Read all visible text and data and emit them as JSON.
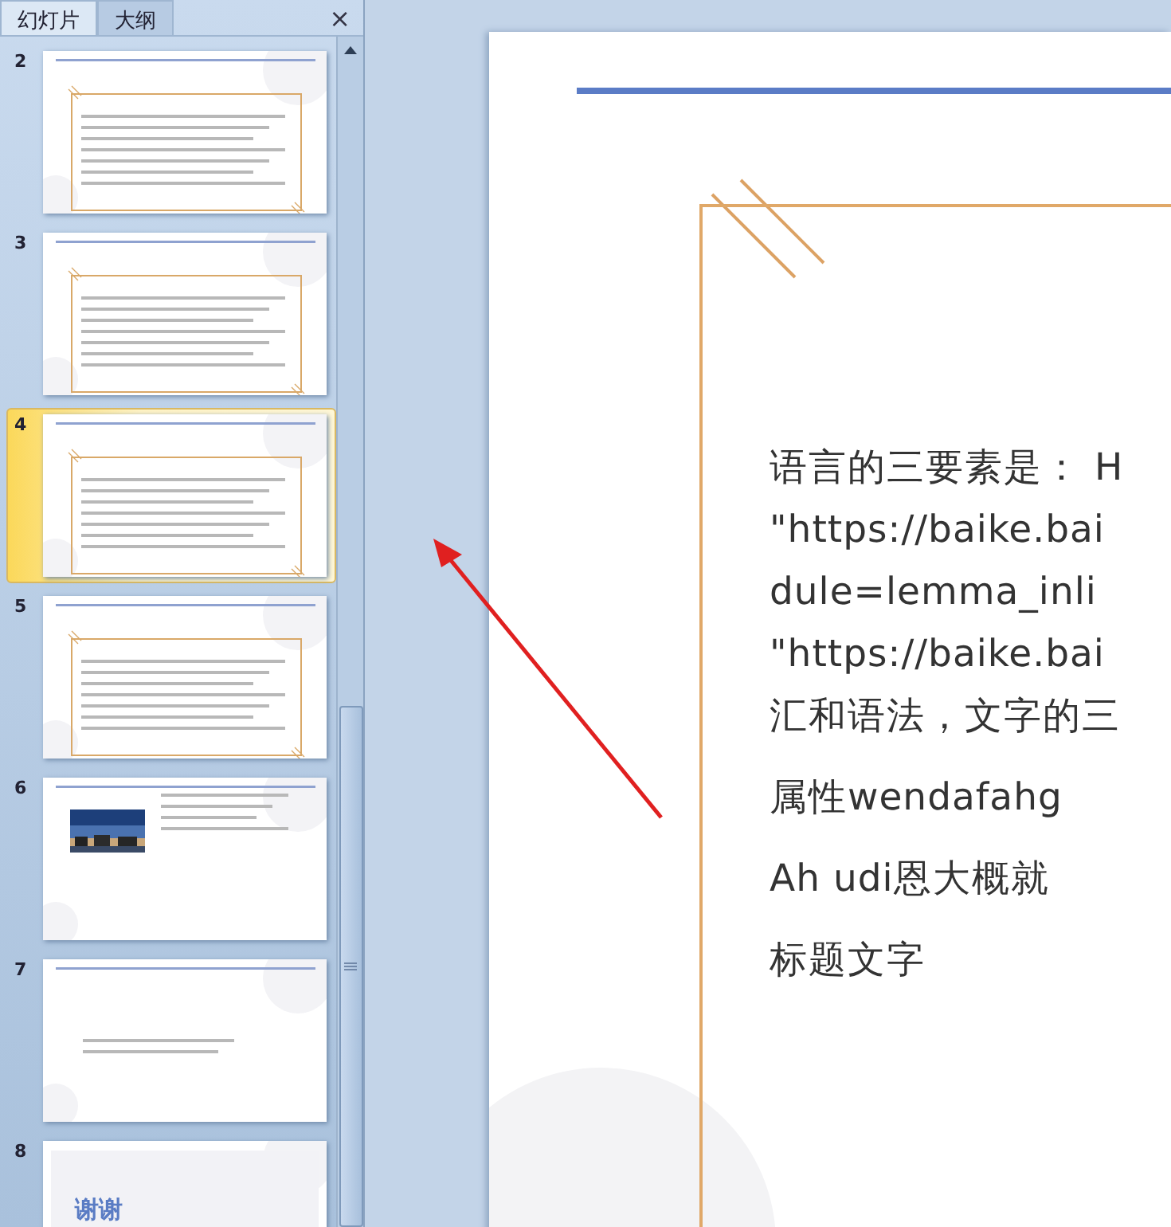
{
  "panel": {
    "tabs": [
      {
        "label": "幻灯片",
        "selected": true
      },
      {
        "label": "大纲",
        "selected": false
      }
    ],
    "close": "×"
  },
  "slides": [
    {
      "number": "2",
      "kind": "text",
      "selected": false
    },
    {
      "number": "3",
      "kind": "text",
      "selected": false
    },
    {
      "number": "4",
      "kind": "text",
      "selected": true
    },
    {
      "number": "5",
      "kind": "text",
      "selected": false
    },
    {
      "number": "6",
      "selected": false
    },
    {
      "number": "7",
      "kind": "bullets",
      "selected": false
    },
    {
      "number": "8",
      "kind": "end",
      "selected": false,
      "title": "谢谢"
    }
  ],
  "slide": {
    "lines": [
      "语言的三要素是： H",
      "\"https://baike.bai",
      "dule=lemma_inli",
      "\"https://baike.bai",
      "汇和语法，文字的三"
    ],
    "paragraphs": [
      "属性wendafahg",
      "Ah udi恩大概就",
      "标题文字"
    ]
  }
}
